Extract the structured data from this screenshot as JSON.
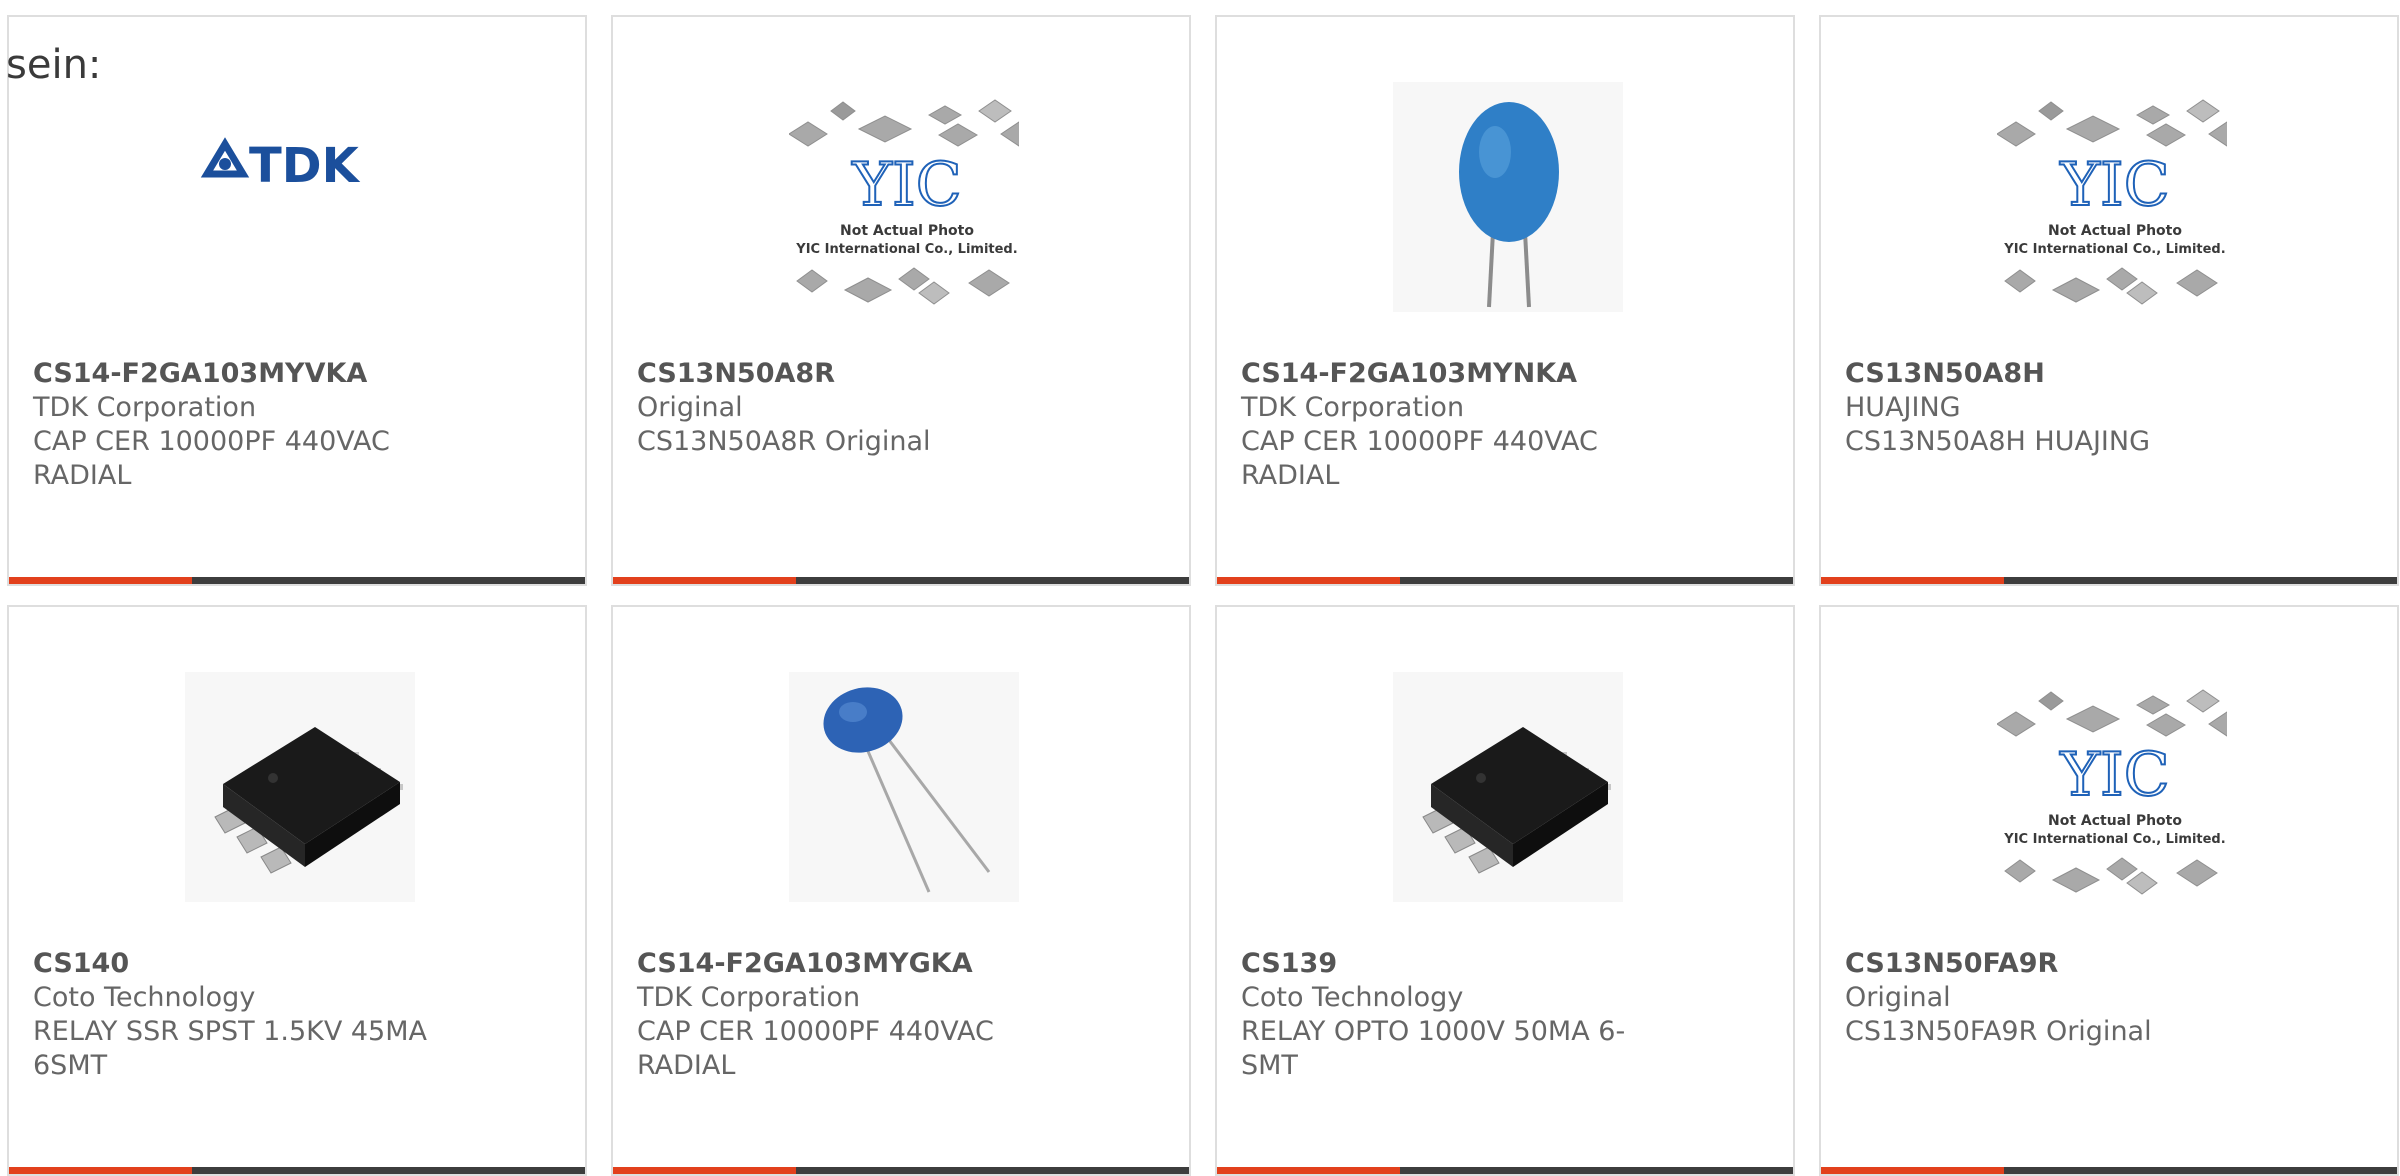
{
  "intro": "sein:",
  "accent_color": "#e2401c",
  "bar_color": "#3d3d3d",
  "cards": [
    {
      "part": "CS14-F2GA103MYVKA",
      "manufacturer": "TDK Corporation",
      "description": "CAP CER 10000PF 440VAC RADIAL",
      "image": "tdk-logo",
      "logo_text": "TDK"
    },
    {
      "part": "CS13N50A8R",
      "manufacturer": "Original",
      "description": "CS13N50A8R Original",
      "image": "yic-placeholder",
      "logo_text": "YIC",
      "caption_1": "Not Actual Photo",
      "caption_2": "YIC International Co., Limited."
    },
    {
      "part": "CS14-F2GA103MYNKA",
      "manufacturer": "TDK Corporation",
      "description": "CAP CER 10000PF 440VAC RADIAL",
      "image": "ceramic-capacitor-upright"
    },
    {
      "part": "CS13N50A8H",
      "manufacturer": "HUAJING",
      "description": "CS13N50A8H HUAJING",
      "image": "yic-placeholder",
      "logo_text": "YIC",
      "caption_1": "Not Actual Photo",
      "caption_2": "YIC International Co., Limited."
    },
    {
      "part": "CS140",
      "manufacturer": "Coto Technology",
      "description": "RELAY SSR SPST 1.5KV 45MA 6SMT",
      "image": "smt-relay-chip"
    },
    {
      "part": "CS14-F2GA103MYGKA",
      "manufacturer": "TDK Corporation",
      "description": "CAP CER 10000PF 440VAC RADIAL",
      "image": "ceramic-capacitor-leaning"
    },
    {
      "part": "CS139",
      "manufacturer": "Coto Technology",
      "description": "RELAY OPTO 1000V 50MA 6-SMT",
      "image": "smt-relay-chip"
    },
    {
      "part": "CS13N50FA9R",
      "manufacturer": "Original",
      "description": "CS13N50FA9R Original",
      "image": "yic-placeholder",
      "logo_text": "YIC",
      "caption_1": "Not Actual Photo",
      "caption_2": "YIC International Co., Limited."
    }
  ]
}
